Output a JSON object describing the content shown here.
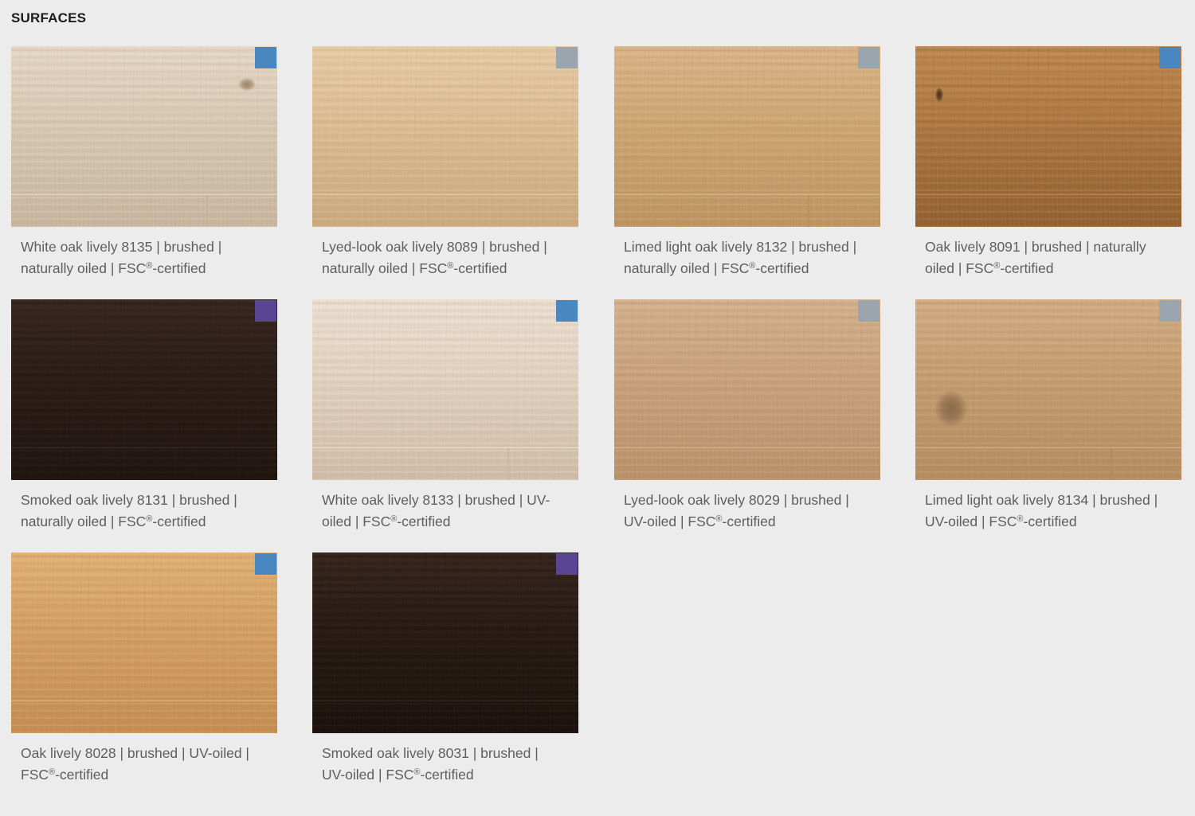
{
  "section": {
    "title": "SURFACES"
  },
  "colors": {
    "page_background": "#ececec",
    "badge_blue": "#4a86bf",
    "badge_grey": "#9aa5ae",
    "badge_purple": "#5a4593"
  },
  "products": [
    {
      "line1": "White oak lively 8135 | brushed |",
      "line2_before": "naturally oiled | FSC",
      "registered": "®",
      "line2_after": "-certified",
      "badge": "badge_blue",
      "wood": {
        "base": "#d9cab5",
        "light": "#e6dac9",
        "dark": "#c4b29a",
        "knot": "#9c8467"
      }
    },
    {
      "line1": "Lyed-look oak lively 8089 | brushed |",
      "line2_before": "naturally oiled | FSC",
      "registered": "®",
      "line2_after": "-certified",
      "badge": "badge_grey",
      "wood": {
        "base": "#dcbf95",
        "light": "#e8cfaa",
        "dark": "#c8a77b",
        "knot": "#b08f64"
      }
    },
    {
      "line1": "Limed light oak lively 8132 | brushed |",
      "line2_before": "naturally oiled | FSC",
      "registered": "®",
      "line2_after": "-certified",
      "badge": "badge_grey",
      "wood": {
        "base": "#cfa878",
        "light": "#dcb98d",
        "dark": "#ba9262",
        "knot": "#a57d50"
      }
    },
    {
      "line1": "Oak lively 8091 | brushed | naturally",
      "line2_before": "oiled | FSC",
      "registered": "®",
      "line2_after": "-certified",
      "badge": "badge_blue",
      "wood": {
        "base": "#b07b46",
        "light": "#c28d56",
        "dark": "#8f5e30",
        "knot": "#4a2e17"
      }
    },
    {
      "line1": "Smoked oak lively 8131 | brushed |",
      "line2_before": "naturally oiled | FSC",
      "registered": "®",
      "line2_after": "-certified",
      "badge": "badge_purple",
      "wood": {
        "base": "#2e1f19",
        "light": "#3c2a22",
        "dark": "#1f1410",
        "knot": "#170e0b"
      }
    },
    {
      "line1": "White oak lively 8133 | brushed | UV-",
      "line2_before": "oiled | FSC",
      "registered": "®",
      "line2_after": "-certified",
      "badge": "badge_blue",
      "wood": {
        "base": "#e3d4c3",
        "light": "#eee2d5",
        "dark": "#ccb9a3",
        "knot": "#b7a18a"
      }
    },
    {
      "line1": "Lyed-look oak lively 8029 | brushed |",
      "line2_before": "UV-oiled | FSC",
      "registered": "®",
      "line2_after": "-certified",
      "badge": "badge_grey",
      "wood": {
        "base": "#c9a47e",
        "light": "#d6b592",
        "dark": "#b58e66",
        "knot": "#9e7a55"
      }
    },
    {
      "line1": "Limed light oak lively 8134 | brushed |",
      "line2_before": "UV-oiled | FSC",
      "registered": "®",
      "line2_after": "-certified",
      "badge": "badge_grey",
      "wood": {
        "base": "#c79f74",
        "light": "#d5b089",
        "dark": "#b28a60",
        "knot": "#8a6a4a"
      }
    },
    {
      "line1": "Oak lively 8028 | brushed | UV-oiled |",
      "line2_before": "FSC",
      "registered": "®",
      "line2_after": "-certified",
      "badge": "badge_blue",
      "wood": {
        "base": "#d5a266",
        "light": "#e3b57c",
        "dark": "#c08c50",
        "knot": "#a87840"
      }
    },
    {
      "line1": "Smoked oak lively 8031 | brushed |",
      "line2_before": "UV-oiled | FSC",
      "registered": "®",
      "line2_after": "-certified",
      "badge": "badge_purple",
      "wood": {
        "base": "#2a1d16",
        "light": "#3a2920",
        "dark": "#1a110c",
        "knot": "#120b08"
      }
    }
  ]
}
